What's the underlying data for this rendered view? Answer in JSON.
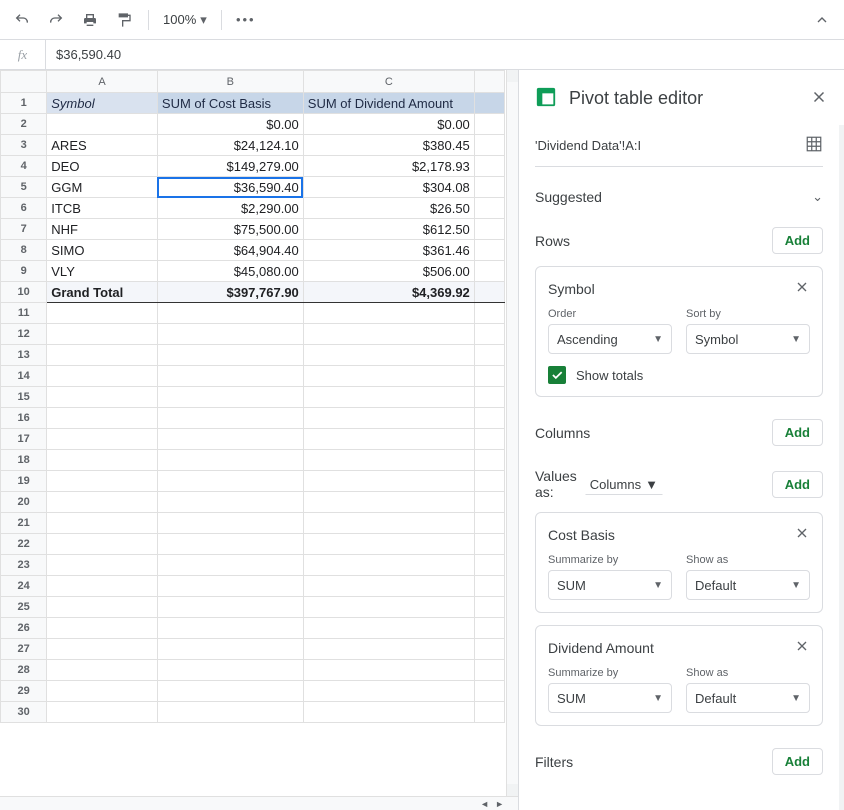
{
  "toolbar": {
    "zoom": "100%"
  },
  "formula_value": "$36,590.40",
  "columns": [
    "A",
    "B",
    "C"
  ],
  "pivot_headers": [
    "Symbol",
    "SUM of Cost Basis",
    "SUM of Dividend Amount"
  ],
  "rows": [
    {
      "symbol": "",
      "cost": "$0.00",
      "div": "$0.00"
    },
    {
      "symbol": "ARES",
      "cost": "$24,124.10",
      "div": "$380.45"
    },
    {
      "symbol": "DEO",
      "cost": "$149,279.00",
      "div": "$2,178.93"
    },
    {
      "symbol": "GGM",
      "cost": "$36,590.40",
      "div": "$304.08"
    },
    {
      "symbol": "ITCB",
      "cost": "$2,290.00",
      "div": "$26.50"
    },
    {
      "symbol": "NHF",
      "cost": "$75,500.00",
      "div": "$612.50"
    },
    {
      "symbol": "SIMO",
      "cost": "$64,904.40",
      "div": "$361.46"
    },
    {
      "symbol": "VLY",
      "cost": "$45,080.00",
      "div": "$506.00"
    }
  ],
  "grand": {
    "label": "Grand Total",
    "cost": "$397,767.90",
    "div": "$4,369.92"
  },
  "empty_row_count": 20,
  "selected_cell": {
    "row": 5,
    "col": "B"
  },
  "panel": {
    "title": "Pivot table editor",
    "range": "'Dividend Data'!A:I",
    "suggested": "Suggested",
    "sections": {
      "rows": {
        "title": "Rows",
        "add": "Add"
      },
      "columns": {
        "title": "Columns",
        "add": "Add"
      },
      "values": {
        "title": "Values as:",
        "dd": "Columns",
        "add": "Add"
      },
      "filters": {
        "title": "Filters",
        "add": "Add"
      }
    },
    "rows_chip": {
      "title": "Symbol",
      "order_label": "Order",
      "order_value": "Ascending",
      "sort_label": "Sort by",
      "sort_value": "Symbol",
      "show_totals": "Show totals"
    },
    "value_chips": [
      {
        "title": "Cost Basis",
        "sum_label": "Summarize by",
        "sum_value": "SUM",
        "show_label": "Show as",
        "show_value": "Default"
      },
      {
        "title": "Dividend Amount",
        "sum_label": "Summarize by",
        "sum_value": "SUM",
        "show_label": "Show as",
        "show_value": "Default"
      }
    ]
  },
  "chart_data": {
    "type": "table",
    "title": "Pivot table — SUM of Cost Basis and Dividend Amount by Symbol",
    "columns": [
      "Symbol",
      "SUM of Cost Basis",
      "SUM of Dividend Amount"
    ],
    "data": [
      [
        "",
        0.0,
        0.0
      ],
      [
        "ARES",
        24124.1,
        380.45
      ],
      [
        "DEO",
        149279.0,
        2178.93
      ],
      [
        "GGM",
        36590.4,
        304.08
      ],
      [
        "ITCB",
        2290.0,
        26.5
      ],
      [
        "NHF",
        75500.0,
        612.5
      ],
      [
        "SIMO",
        64904.4,
        361.46
      ],
      [
        "VLY",
        45080.0,
        506.0
      ]
    ],
    "totals": [
      "Grand Total",
      397767.9,
      4369.92
    ]
  }
}
